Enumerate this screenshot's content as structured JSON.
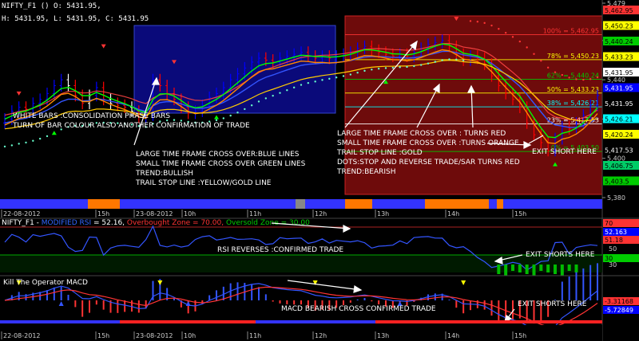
{
  "header": {
    "symbol_line": "NIFTY_F1 () O: 5431.95,",
    "ohlc_line": "H: 5431.95, L: 5431.95, C: 5431.95"
  },
  "price_axis": {
    "ticks": [
      "5,479",
      "5,460",
      "5,440",
      "5,420",
      "5,400",
      "5,380"
    ],
    "markers": [
      {
        "label": "5,462.95",
        "bg": "#ff3333",
        "fg": "#000000"
      },
      {
        "label": "5,450.23",
        "bg": "#ffff00",
        "fg": "#000000"
      },
      {
        "label": "5,440.24",
        "bg": "#00cc00",
        "fg": "#000000"
      },
      {
        "label": "5,433.23",
        "bg": "#ffff00",
        "fg": "#000000"
      },
      {
        "label": "5,431.95",
        "bg": "#ffffff",
        "fg": "#000000"
      },
      {
        "label": "5,431.95",
        "bg": "#0000ff",
        "fg": "#ffffff"
      },
      {
        "label": "5,431.95",
        "bg": "#000000",
        "fg": "#ffffff"
      },
      {
        "label": "5,426.21",
        "bg": "#00ffff",
        "fg": "#000000"
      },
      {
        "label": "5,420.24",
        "bg": "#ffff00",
        "fg": "#000000"
      },
      {
        "label": "5,417.53",
        "bg": "#000000",
        "fg": "#ffffff"
      },
      {
        "label": "5,406.75",
        "bg": "#00cc66",
        "fg": "#000000"
      },
      {
        "label": "5,403.5",
        "bg": "#00cc00",
        "fg": "#000000"
      }
    ]
  },
  "fib_levels": [
    {
      "label": "100% = 5,462.95",
      "price": 5462.95,
      "color": "#ff3333"
    },
    {
      "label": "78% = 5,450.23",
      "price": 5450.23,
      "color": "#ffff00"
    },
    {
      "label": "62% = 5,440.24",
      "price": 5440.24,
      "color": "#00cc00"
    },
    {
      "label": "50% = 5,433.23",
      "price": 5433.23,
      "color": "#ffff00"
    },
    {
      "label": "38% = 5,426.21",
      "price": 5426.21,
      "color": "#00ffff"
    },
    {
      "label": "23% = 5,417.53",
      "price": 5417.53,
      "color": "#ffffff"
    },
    {
      "label": "0% = 5,403.50",
      "price": 5403.5,
      "color": "#00cc00"
    }
  ],
  "annotations": {
    "white_bars": [
      "WHITE BARS :CONSOLIDATION PHASE BARS",
      "TURN OF BAR COLOUR ALSO ANOTHER CONFIRMATION OF TRADE"
    ],
    "bullish": [
      "LARGE TIME FRAME CROSS OVER:BLUE LINES",
      "SMALL TIME FRAME CROSS OVER GREEN LINES",
      "TREND:BULLISH",
      "TRAIL STOP LINE :YELLOW/GOLD LINE"
    ],
    "bearish": [
      "LARGE TIME FRAME CROSS OVER : TURNS RED",
      "SMALL TIME FRAME CROSS OVER :TURNS ORANGE",
      "TRAIL STOP LINE :GOLD",
      "DOTS:STOP AND REVERSE TRADE/SAR TURNS RED",
      "TREND:BEARISH"
    ],
    "exit_short": "EXIT SHORT HERE",
    "rsi_note": "RSI REVERSES :CONFIRMED TRADE",
    "rsi_exit": "EXIT SHORTS HERE",
    "macd_note": "MACD BEARISH CROSS CONFIRMED TRADE",
    "macd_exit": "EXIT SHORTS HERE"
  },
  "time_axis": [
    "22-08-2012",
    "15h",
    "23-08-2012",
    "10h",
    "11h",
    "12h",
    "13h",
    "14h",
    "15h"
  ],
  "rsi": {
    "title_prefix": "NIFTY_F1 - ",
    "title_name": "MODIFIED RSI",
    "title_value": " = 52.16, ",
    "overbought": "Overbought Zone = 70.00, ",
    "oversold": "Oversold Zone = 30.00",
    "ticks": [
      "70",
      "60",
      "50",
      "40",
      "30"
    ],
    "markers": [
      {
        "label": "70",
        "bg": "#ff3333",
        "fg": "#000000"
      },
      {
        "label": "52.163",
        "bg": "#0000ff",
        "fg": "#ffffff"
      },
      {
        "label": "51.18",
        "bg": "#ff3333",
        "fg": "#000000"
      },
      {
        "label": "30",
        "bg": "#00cc00",
        "fg": "#000000"
      }
    ]
  },
  "macd": {
    "title": "Kill The Operator MACD",
    "ticks": [
      "0"
    ],
    "markers": [
      {
        "label": "-3.31168",
        "bg": "#ff3333",
        "fg": "#000000"
      },
      {
        "label": "-5.72849",
        "bg": "#0000ff",
        "fg": "#ffffff"
      }
    ]
  },
  "colors": {
    "bull_bar": "#0000ff",
    "bear_bar": "#ff0000",
    "neutral_bar": "#ffffff",
    "fast_ma": "#00ff00",
    "slow_ma": "#ff8800",
    "trail_stop": "#ffcc00",
    "sar_dots": "#66ffcc",
    "blue_zone": "#0a0a7a",
    "red_zone": "#7a0a0a"
  },
  "chart_data": {
    "type": "line",
    "instrument": "NIFTY_F1",
    "timeframe_dates": [
      "22-08-2012",
      "23-08-2012"
    ],
    "ohlc_last": {
      "open": 5431.95,
      "high": 5431.95,
      "low": 5431.95,
      "close": 5431.95
    },
    "price_range": [
      5380,
      5479
    ],
    "close": [
      5420,
      5424,
      5426,
      5425,
      5428,
      5430,
      5433,
      5437,
      5440,
      5437,
      5432,
      5428,
      5432,
      5436,
      5430,
      5428,
      5427,
      5426,
      5424,
      5421,
      5422,
      5440,
      5437,
      5433,
      5430,
      5426,
      5423,
      5424,
      5427,
      5431,
      5433,
      5436,
      5440,
      5443,
      5446,
      5449,
      5451,
      5450,
      5449,
      5451,
      5452,
      5453,
      5454,
      5452,
      5451,
      5452,
      5451,
      5452,
      5453,
      5454,
      5456,
      5457,
      5455,
      5454,
      5453,
      5452,
      5453,
      5452,
      5454,
      5456,
      5458,
      5459,
      5460,
      5457,
      5453,
      5450,
      5452,
      5451,
      5448,
      5442,
      5437,
      5433,
      5430,
      5426,
      5418,
      5412,
      5408,
      5404,
      5410,
      5416,
      5415,
      5418,
      5422,
      5427,
      5432
    ]
  }
}
